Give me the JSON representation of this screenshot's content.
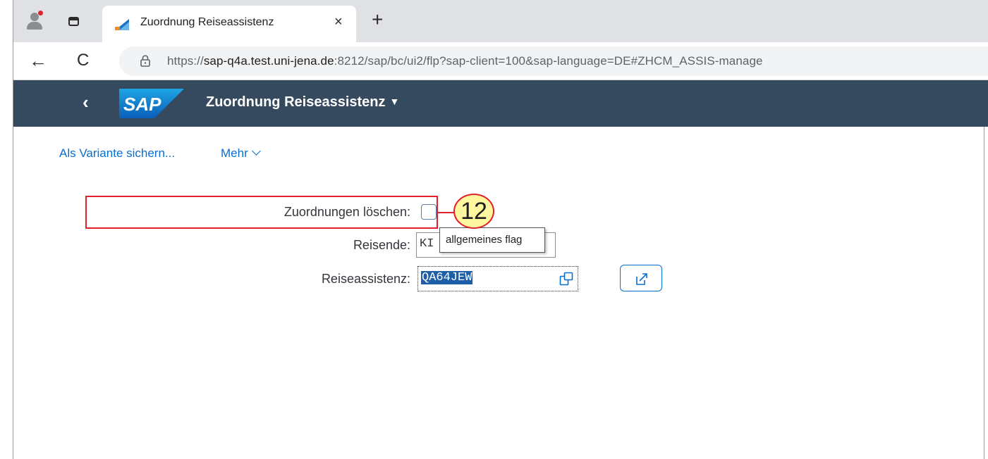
{
  "browser": {
    "tab": {
      "title": "Zuordnung Reiseassistenz",
      "close_glyph": "×"
    },
    "new_tab_glyph": "+",
    "nav": {
      "back_glyph": "←",
      "reload_glyph": "C"
    },
    "url": {
      "scheme": "https://",
      "host": "sap-q4a.test.uni-jena.de",
      "rest": ":8212/sap/bc/ui2/flp?sap-client=100&sap-language=DE#ZHCM_ASSIS-manage"
    },
    "icons": [
      "profile-icon",
      "tab-actions-icon",
      "favicon-icon",
      "lock-icon"
    ]
  },
  "shell": {
    "back_glyph": "‹",
    "logo_text": "SAP",
    "title": "Zuordnung Reiseassistenz",
    "title_caret": "▼",
    "colors": {
      "bar": "#354a5f",
      "logo": "#0a6ed1"
    }
  },
  "toolbar": {
    "save_variant": "Als Variante sichern...",
    "more": "Mehr"
  },
  "form": {
    "delete_label": "Zuordnungen löschen:",
    "traveler_label": "Reisende:",
    "traveler_value": "KI",
    "assistant_label": "Reiseassistenz:",
    "assistant_value": "QA64JEW",
    "delete_checked": false
  },
  "tooltip": {
    "text": "allgemeines flag"
  },
  "annotation": {
    "step": "12",
    "color": "#e0202a"
  }
}
